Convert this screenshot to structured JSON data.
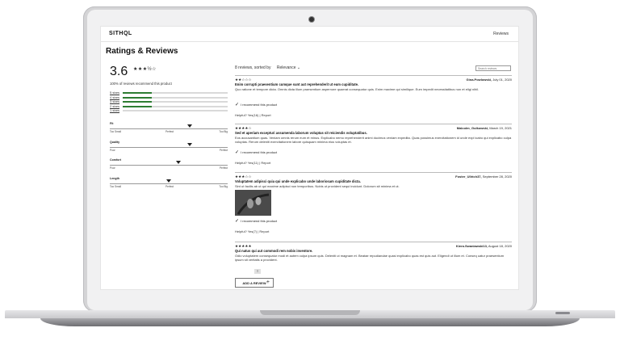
{
  "header": {
    "logo": "SITHQL",
    "nav_reviews": "Reviews"
  },
  "page": {
    "title": "Ratings & Reviews"
  },
  "summary": {
    "average": "3.6",
    "stars": "★★★½☆",
    "recommend_text": "100% of reviews recommend this product",
    "distribution": [
      {
        "label": "5 stars",
        "fraction": 0.28
      },
      {
        "label": "4 stars",
        "fraction": 0.28
      },
      {
        "label": "3 stars",
        "fraction": 0.28
      },
      {
        "label": "2 stars",
        "fraction": 0.28
      },
      {
        "label": "1 stars",
        "fraction": 0.0
      }
    ]
  },
  "factors": [
    {
      "name": "Fit",
      "low": "Too Small",
      "mid": "Perfect",
      "high": "Too Big",
      "level": 0.68
    },
    {
      "name": "Quality",
      "low": "Poor",
      "mid": "",
      "high": "Perfect",
      "level": 0.68
    },
    {
      "name": "Comfort",
      "low": "Poor",
      "mid": "",
      "high": "Perfect",
      "level": 0.58
    },
    {
      "name": "Length",
      "low": "Too Small",
      "mid": "Perfect",
      "high": "Too Big",
      "level": 0.5
    }
  ],
  "sort": {
    "count_text": "8 reviews, sorted by",
    "selected": "Relevance ⌄"
  },
  "search": {
    "placeholder": "Search reviews"
  },
  "reviews": [
    {
      "stars": "★★☆☆☆",
      "author": "Gina.Powlowski,",
      "date": " July 01, 2020",
      "title": "Enim corrupti praesentium cumque sunt aut reprehenderit ut eum cupiditate.",
      "body": "Quo ratione et tempore dicta. Omnis dicta illum praesentium aspernore quaerat consequatur quis. Enim maxime qui similique. Eum impedit necessitatibus non et eligi nihil.",
      "recommend": "I recommend this product",
      "helpful": "Helpful?   Yes(16)  |  Report"
    },
    {
      "stars": "★★★★☆",
      "author": "Malcolm_Gulkowski,",
      "date": " March 19, 2021",
      "title": "Sed et aperiam excepturi assumenda laborum voluptas sit reiciendis voluptatibus.",
      "body": "Eos accusantium quas. Veniam omnis rerum eum et minus. Explicabo nemo reprehenderit animi ducimus veniam expedita. Quas possimus exercitationem id unde expl icabo qui explicabo culpa voluptas. Rerum deleniti exercitationem labore quisquam minima eius voluptas et.",
      "recommend": "I recommend this product",
      "helpful": "Helpful?   Yes(11)  |  Report"
    },
    {
      "stars": "★★★☆☆",
      "author": "Foster_Ullrich37,",
      "date": " September 28, 2020",
      "title": "Voluptatem adipisci quia qui unde explicabo unde laboriosam cupiditate dicta.",
      "body": "Sint ut facilis ab ut qui maxime adipisci non temporibus. Nobis ut provident sequi incidunt. Dolorum sit minima et ut.",
      "recommend": "I recommend this product",
      "helpful": "Helpful?   Yes(7)  |  Report"
    },
    {
      "stars": "★★★★★",
      "author": "Kiera.Swaniawski13,",
      "date": " August 18, 2020",
      "title": "Qui natus qui aut commodi rem nobis inventore.",
      "body": "Odio voluptatem consequatur modi et autem culpa ipsum quis. Deleniti ut magnam et. Beatae repudiandae quasi explicabo quas est quis aut. Eligendi ut illum et. Conseq uatur praesentium ipsum sit veritatis a provident.",
      "recommend": "",
      "helpful": ""
    }
  ],
  "scroll_button": "⇧",
  "add_review": {
    "label": "ADD A REVIEW",
    "icon": "plus-icon",
    "symbol": "+"
  },
  "colors": {
    "bar_fill": "#2e7d32",
    "bar_track": "#d9d9d9",
    "lid": "#d4d4d6"
  }
}
